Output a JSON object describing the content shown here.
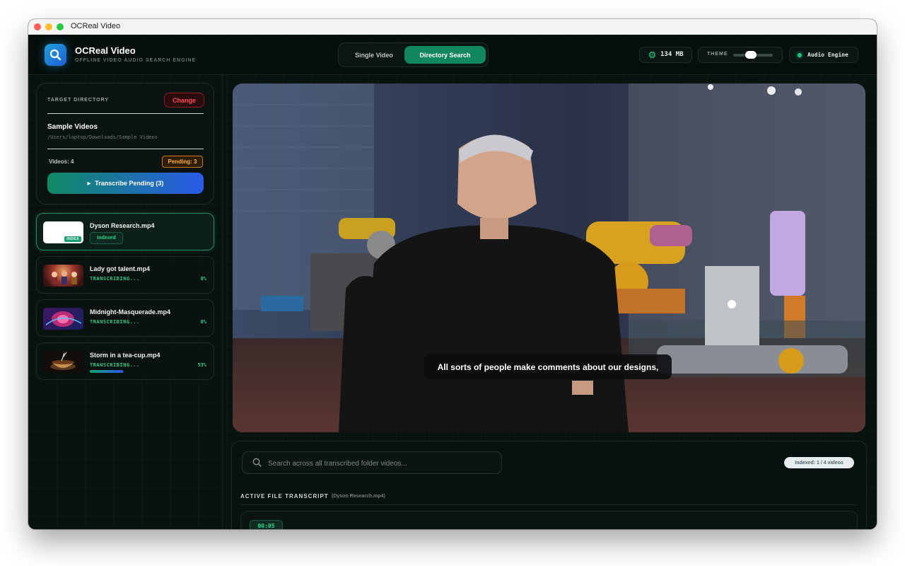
{
  "window": {
    "title": "OCReal Video"
  },
  "header": {
    "brand_title": "OCReal Video",
    "brand_subtitle": "OFFLINE VIDEO AUDIO SEARCH ENGINE",
    "tabs": [
      {
        "label": "Single Video",
        "active": false
      },
      {
        "label": "Directory Search",
        "active": true
      }
    ],
    "memory": "134 MB",
    "theme_label": "THEME",
    "engine_label": "Audio Engine"
  },
  "sidebar": {
    "target_label": "TARGET DIRECTORY",
    "change_label": "Change",
    "dir_name": "Sample Videos",
    "dir_path": "/Users/laptop/Downloads/Sample Videos",
    "videos_count": "Videos: 4",
    "pending": "Pending: 3",
    "transcribe_label": "Transcribe Pending (3)",
    "videos": [
      {
        "name": "Dyson Research.mp4",
        "status": "Indexed",
        "tag": "INDEX"
      },
      {
        "name": "Lady got talent.mp4",
        "status": "TRANSCRIBING...",
        "percent": "0%",
        "progress": 0
      },
      {
        "name": "Midnight-Masquerade.mp4",
        "status": "TRANSCRIBING...",
        "percent": "0%",
        "progress": 0
      },
      {
        "name": "Storm in a tea-cup.mp4",
        "status": "TRANSCRIBING...",
        "percent": "53%",
        "progress": 0.53
      }
    ]
  },
  "player": {
    "caption": "All sorts of people make comments about our designs,"
  },
  "search": {
    "placeholder": "Search across all transcribed folder videos...",
    "indexed_count": "Indexed: 1 / 4 videos"
  },
  "transcript": {
    "title": "ACTIVE FILE TRANSCRIPT",
    "file": "(Dyson Research.mp4)",
    "entries": [
      {
        "time": "00:05"
      }
    ]
  },
  "colors": {
    "accent": "#10875f",
    "danger": "#ff4c55",
    "warning": "#ffb037",
    "blue": "#2a5be8"
  }
}
